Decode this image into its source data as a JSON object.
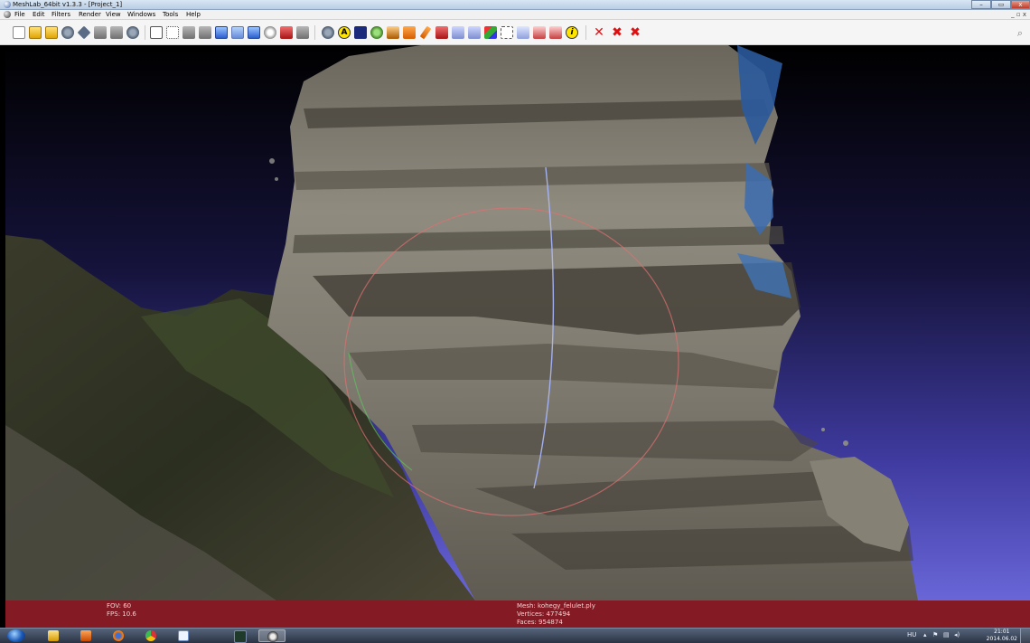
{
  "window": {
    "title": "MeshLab_64bit v1.3.3 - [Project_1]",
    "controls": {
      "minimize": "–",
      "maximize": "▭",
      "close": "x"
    },
    "mdi_controls": "_ ▫ x"
  },
  "menu": [
    "File",
    "Edit",
    "Filters",
    "Render",
    "View",
    "Windows",
    "Tools",
    "Help"
  ],
  "toolbar": {
    "icons": [
      "new-project-icon",
      "open-project-icon",
      "import-mesh-icon",
      "reload-icon",
      "export-mesh-icon",
      "snapshot-icon",
      "layer-dialog-icon",
      "stack-icon",
      "bounding-box-icon",
      "points-icon",
      "wireframe-icon",
      "hidden-lines-icon",
      "flat-lines-icon",
      "flat-icon",
      "smooth-icon",
      "texture-icon",
      "light-icon",
      "backface-icon",
      "double-side-icon",
      "trackball-icon",
      "info-circle-icon",
      "navy-box-icon",
      "globe-icon",
      "measure-icon",
      "pick-point-icon",
      "paint-icon",
      "select-faces-icon",
      "select-vertices-icon",
      "align-icon",
      "color-paint-icon",
      "selection-area-icon",
      "clean-icon",
      "edit-tool-icon",
      "info-icon",
      "delete-selection-icon",
      "delete-faces-icon",
      "delete-vertices-icon"
    ],
    "info_button_glyph": "i",
    "trackball_glyph": "A",
    "delete_glyphs": [
      "✕",
      "✖",
      "✖"
    ]
  },
  "viewport_info": {
    "fov": "FOV: 60",
    "fps": "FPS:  10.6",
    "mesh": "Mesh: kohegy_felulet.ply",
    "vertices": "Vertices: 477494",
    "faces": "Faces: 954874"
  },
  "colors": {
    "sky_top": "#000000",
    "sky_bottom": "#6966d8",
    "info_bar": "#961e28",
    "trackball_red": "#e07070",
    "trackball_blue": "#aab8ff",
    "trackball_green": "#60c060"
  },
  "taskbar": {
    "apps": [
      "windows-explorer-icon",
      "media-player-icon",
      "firefox-icon",
      "chrome-icon",
      "notepad-icon",
      "terminal-icon",
      "meshlab-icon"
    ],
    "language": "HU",
    "time": "21:01",
    "date": "2014.06.02"
  }
}
